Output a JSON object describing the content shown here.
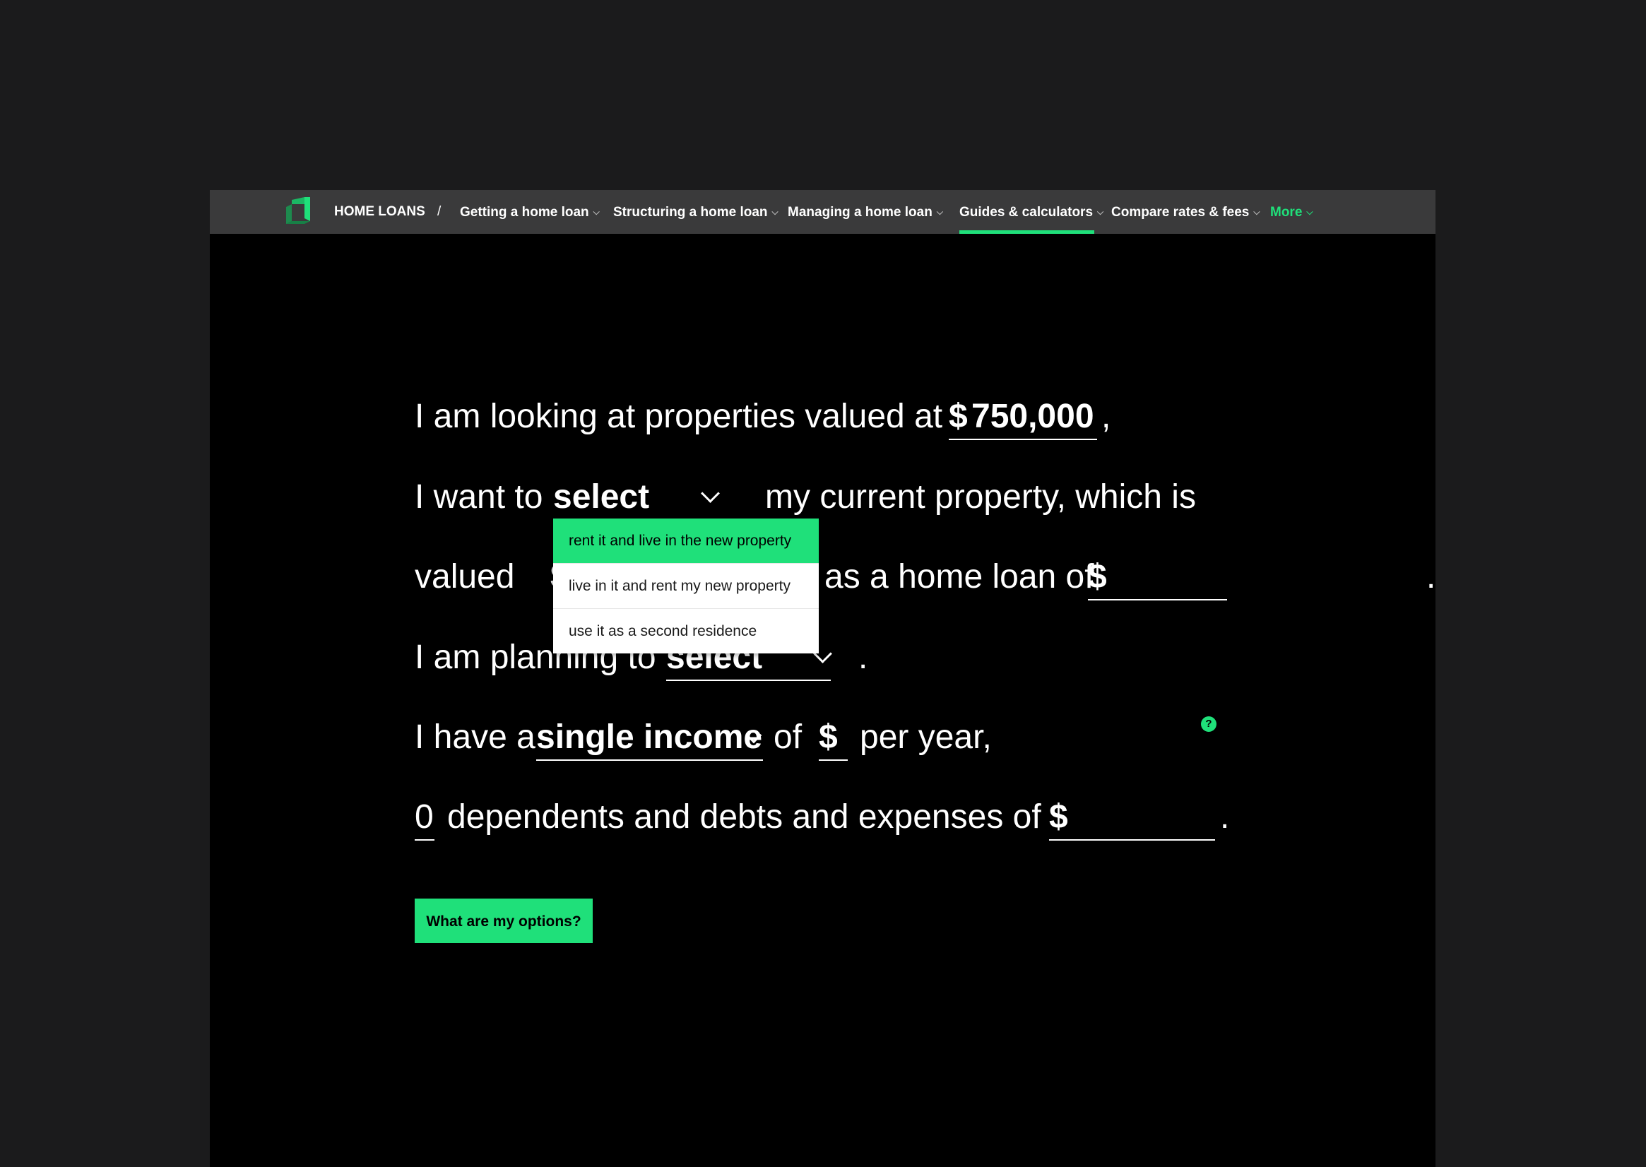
{
  "nav": {
    "crumb": "HOME LOANS",
    "separator": "/",
    "items": [
      {
        "label": "Getting a home loan"
      },
      {
        "label": "Structuring a home loan"
      },
      {
        "label": "Managing a home loan"
      },
      {
        "label": "Guides & calculators"
      },
      {
        "label": "Compare rates & fees"
      },
      {
        "label": "More"
      }
    ],
    "chevron": "⌵"
  },
  "form": {
    "line1": {
      "prefix": "I am looking at properties valued at",
      "currency": "$",
      "value": "750,000",
      "suffix": ","
    },
    "line2": {
      "prefix": "I want to",
      "select_value": "select",
      "suffix": "my current property, which is"
    },
    "line3": {
      "prefix": "valued",
      "currency_hidden": "$",
      "middle": "as a home loan of",
      "currency": "$",
      "value": "",
      "suffix": "."
    },
    "line4": {
      "prefix": "I am planning to",
      "select_value": "select",
      "suffix": "."
    },
    "line5": {
      "prefix": "I have a",
      "select_value": "single income",
      "mid": "of",
      "currency": "$",
      "value": "",
      "suffix": "per year,",
      "help": "?"
    },
    "line6": {
      "dependents": "0",
      "mid": "dependents and debts and expenses of",
      "currency": "$",
      "value": "",
      "suffix": "."
    }
  },
  "dropdown": {
    "options": [
      {
        "label": "rent it and live in the new property",
        "selected": true
      },
      {
        "label": "live in it and rent my new property",
        "selected": false
      },
      {
        "label": "use it as a second residence",
        "selected": false
      }
    ]
  },
  "cta": {
    "label": "What are my options?"
  },
  "colors": {
    "accent": "#1fe07a",
    "nav_bg": "#3a3a3b",
    "page_bg": "#000000",
    "outer_bg": "#1b1b1c"
  }
}
